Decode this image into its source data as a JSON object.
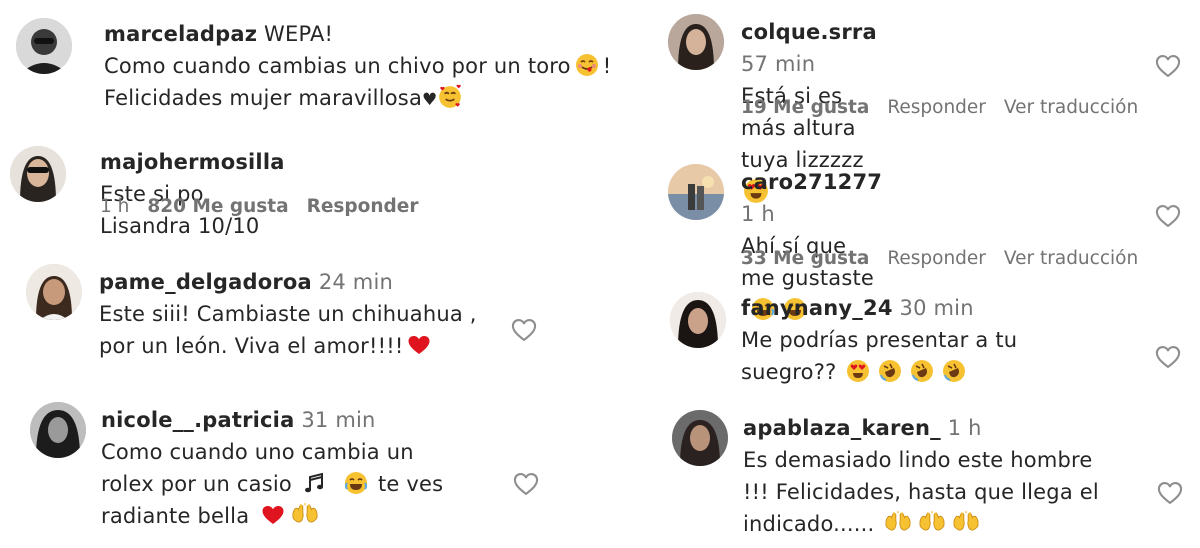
{
  "comments": [
    {
      "username": "marceladpaz",
      "line1_rest": "WEPA!",
      "line2": "Como cuando cambias un chivo por un toro",
      "line2_end": "!",
      "line3": "Felicidades mujer maravillosa",
      "heart_symbol": "♥"
    },
    {
      "username": "majohermosilla",
      "text": "Este si po Lisandra 10/10",
      "time": "1 h",
      "likes": "820 Me gusta",
      "reply": "Responder"
    },
    {
      "username": "pame_delgadoroa",
      "time": "24 min",
      "line1": "Este siii! Cambiaste un chihuahua ,",
      "line2": "por un león. Viva el amor!!!!"
    },
    {
      "username": "nicole__.patricia",
      "time": "31 min",
      "line1": "Como cuando uno cambia un",
      "line2a": "rolex por un casio",
      "line2b": "te ves",
      "line3": "radiante bella"
    },
    {
      "username": "colque.srra",
      "time": "57 min",
      "text": "Está si es más altura tuya lizzzzz",
      "likes": "19 Me gusta",
      "reply": "Responder",
      "translate": "Ver traducción"
    },
    {
      "username": "caro271277",
      "time": "1 h",
      "text": "Ahí sí que me gustaste",
      "likes": "33 Me gusta",
      "reply": "Responder",
      "translate": "Ver traducción"
    },
    {
      "username": "fanynany_24",
      "time": "30 min",
      "line1": "Me podrías presentar a tu",
      "line2": "suegro??"
    },
    {
      "username": "apablaza_karen_",
      "time": "1 h",
      "line1": "Es demasiado lindo este hombre",
      "line2": "!!! Felicidades, hasta que llega el",
      "line3": "indicado......"
    }
  ],
  "icons": {
    "like": "heart-outline-icon",
    "avatar": "avatar-photo"
  },
  "colors": {
    "text": "#262626",
    "secondary": "#737373",
    "emoji_yellow": "#f7c232",
    "red_heart": "#e0141e"
  }
}
